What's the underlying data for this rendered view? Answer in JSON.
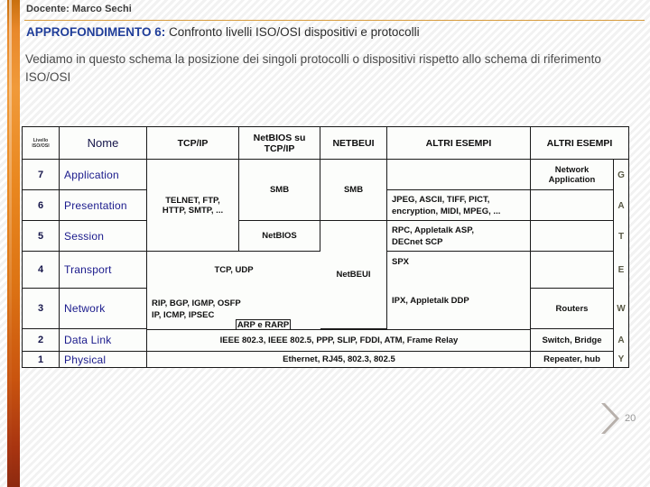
{
  "slide": {
    "docente": "Docente: Marco Sechi",
    "title_strong": "APPROFONDIMENTO 6:",
    "title_rest": " Confronto livelli ISO/OSI dispositivi e protocolli",
    "lead": "Vediamo in questo schema la posizione dei singoli protocolli o dispositivi rispetto allo schema di riferimento ISO/OSI",
    "page_number": "20",
    "accent_orange": "#e9871f",
    "accent_blue": "#1f3d99",
    "rule_color": "#d79b3c"
  },
  "table": {
    "headers": {
      "level_line1": "Livello",
      "level_line2": "ISO/OSI",
      "name": "Nome",
      "tcpip": "TCP/IP",
      "netbios_line1": "NetBIOS su",
      "netbios_line2": "TCP/IP",
      "netbeui": "NETBEUI",
      "altri1": "ALTRI ESEMPI",
      "altri2": "ALTRI ESEMPI"
    },
    "levels": [
      {
        "num": "7",
        "name": "Application"
      },
      {
        "num": "6",
        "name": "Presentation"
      },
      {
        "num": "5",
        "name": "Session"
      },
      {
        "num": "4",
        "name": "Transport"
      },
      {
        "num": "3",
        "name": "Network"
      },
      {
        "num": "2",
        "name": "Data Link"
      },
      {
        "num": "1",
        "name": "Physical"
      }
    ],
    "tcpip": {
      "app_pres_ses": "TELNET, FTP,\nHTTP, SMTP, ...",
      "transport": "TCP, UDP",
      "network_line1": "RIP, BGP, IGMP, OSFP",
      "network_line2": "IP, ICMP, IPSEC"
    },
    "netbios_col": {
      "smb": "SMB",
      "netbios": "NetBIOS"
    },
    "netbeui_col": {
      "smb": "SMB",
      "netbeui": "NetBEUI"
    },
    "altri1_col": {
      "presentation": "JPEG, ASCII, TIFF, PICT,\nencryption, MIDI, MPEG, ...",
      "session": "RPC, Appletalk ASP,\nDECnet SCP",
      "transport": "SPX",
      "network": "IPX, Appletalk DDP"
    },
    "altri2_col": {
      "application": "Network\nApplication",
      "network": "Routers",
      "datalink": "Switch, Bridge",
      "physical": "Repeater, hub"
    },
    "shared": {
      "arp": "ARP e RARP",
      "datalink": "IEEE 802.3, IEEE 802.5, PPP, SLIP, FDDI, ATM, Frame Relay",
      "physical": "Ethernet, RJ45, 802.3, 802.5"
    },
    "gateway_letters": [
      "G",
      "A",
      "T",
      "E",
      "W",
      "A",
      "Y"
    ]
  }
}
